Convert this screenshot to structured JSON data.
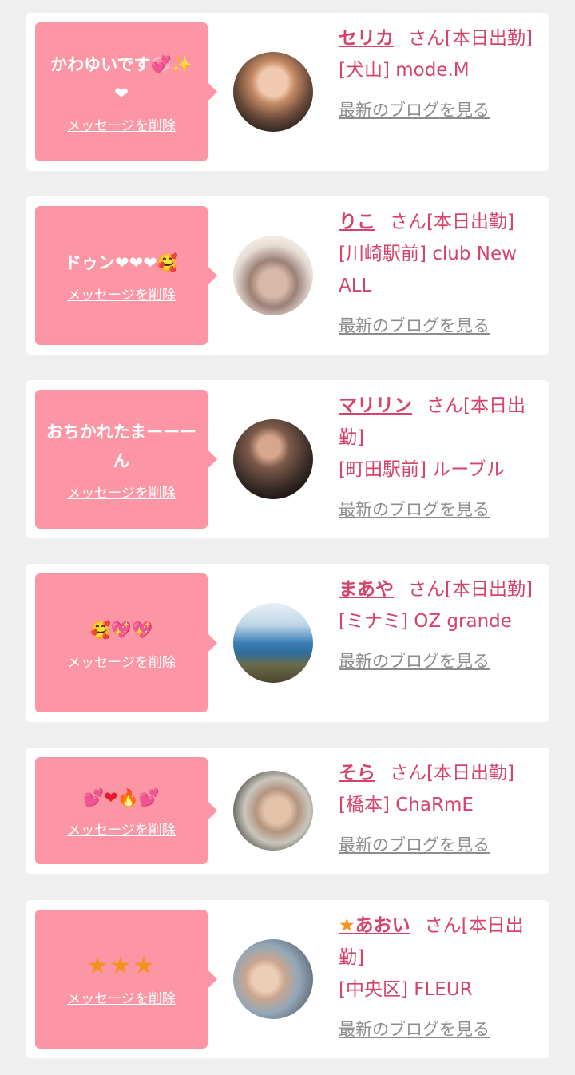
{
  "delete_label": "メッセージを削除",
  "blog_label": "最新のブログを見る",
  "colors": {
    "background": "#f0f0f0",
    "bubble": "#fc96a4",
    "name": "#d6436a",
    "link_gray": "#8c8c8c"
  },
  "cards": [
    {
      "message": "かわゆいです💞✨❤",
      "name": "セリカ",
      "suffix": "さん[本日出勤]",
      "area": "[犬山] mode.M"
    },
    {
      "message": "ドゥン❤❤❤🥰",
      "name": "りこ",
      "suffix": "さん[本日出勤]",
      "area": "[川崎駅前] club New ALL"
    },
    {
      "message": "おちかれたまーーーん",
      "name": "マリリン",
      "suffix": "さん[本日出勤]",
      "area": "[町田駅前] ルーブル"
    },
    {
      "message": "🥰💖💖",
      "name": "まあや",
      "suffix": "さん[本日出勤]",
      "area": "[ミナミ] OZ grande"
    },
    {
      "message": "💕❤🔥💕",
      "name": "そら",
      "suffix": "さん[本日出勤]",
      "area": "[橋本] ChaRmE"
    },
    {
      "message": "★★★",
      "name_star": "★",
      "name": "あおい",
      "suffix": "さん[本日出勤]",
      "area": "[中央区] FLEUR"
    }
  ]
}
